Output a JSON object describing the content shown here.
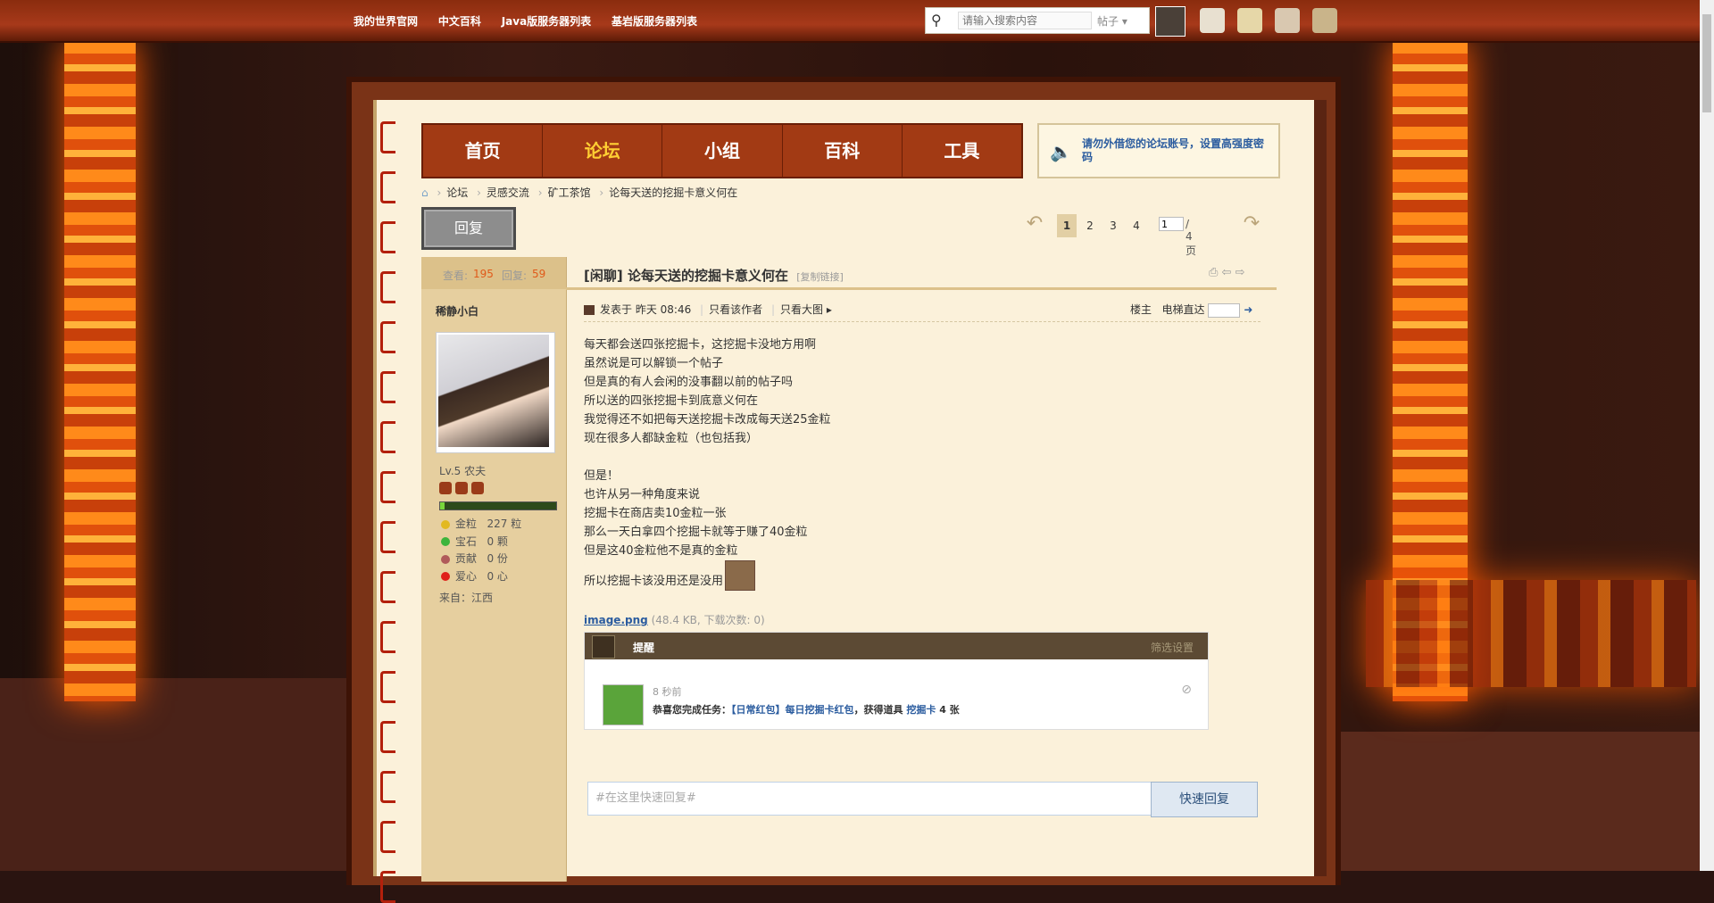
{
  "topnav": [
    "我的世界官网",
    "中文百科",
    "Java版服务器列表",
    "基岩版服务器列表"
  ],
  "search": {
    "placeholder": "请输入搜索内容",
    "type": "帖子"
  },
  "mainnav": [
    "首页",
    "论坛",
    "小组",
    "百科",
    "工具"
  ],
  "notice": "请勿外借您的论坛账号，设置高强度密码",
  "breadcrumb": [
    "论坛",
    "灵感交流",
    "矿工茶馆",
    "论每天送的挖掘卡意义何在"
  ],
  "reply_button": "回复",
  "pager": {
    "pages": [
      "1",
      "2",
      "3",
      "4"
    ],
    "current": "1",
    "input": "1",
    "total": "/ 4 页"
  },
  "stats": {
    "views_label": "查看:",
    "views": "195",
    "replies_label": "回复:",
    "replies": "59"
  },
  "author": {
    "name": "稀静小白",
    "level": "Lv.5 农夫",
    "xp_fraction": 0.04,
    "gold_label": "金粒",
    "gold": "227 粒",
    "gem_label": "宝石",
    "gem": "0 颗",
    "contrib_label": "贡献",
    "contrib": "0 份",
    "love_label": "爱心",
    "love": "0 心",
    "from": "来自：江西"
  },
  "post": {
    "tag": "[闲聊]",
    "title": "论每天送的挖掘卡意义何在",
    "copy_link": "[复制链接]",
    "posted": "发表于 昨天 08:46",
    "only_author": "只看该作者",
    "big_image": "只看大图",
    "floor_label": "楼主",
    "jump_label": "电梯直达",
    "lines": [
      "每天都会送四张挖掘卡，这挖掘卡没地方用啊",
      "虽然说是可以解锁一个帖子",
      "但是真的有人会闲的没事翻以前的帖子吗",
      "所以送的四张挖掘卡到底意义何在",
      "我觉得还不如把每天送挖掘卡改成每天送25金粒",
      "现在很多人都缺金粒（也包括我）",
      "",
      "但是！",
      "也许从另一种角度来说",
      "挖掘卡在商店卖10金粒一张",
      "那么一天白拿四个挖掘卡就等于赚了40金粒",
      "但是这40金粒他不是真的金粒"
    ],
    "last_line": "所以挖掘卡该没用还是没用",
    "attachment": "image.png",
    "attachment_info": "(48.4 KB, 下载次数: 0)"
  },
  "popup": {
    "title": "提醒",
    "settings": "筛选设置",
    "time": "8 秒前",
    "msg_pre": "恭喜您完成任务：",
    "task": "【日常红包】每日挖掘卡红包",
    "msg_mid": "，获得道具",
    "item": "挖掘卡",
    "msg_post": "4 张"
  },
  "quick_reply": {
    "placeholder": "#在这里快速回复#",
    "button": "快速回复"
  },
  "colors": {
    "nav": "#a23a14",
    "active_nav": "#ffcf33",
    "link": "#2b5c9f",
    "paper": "#fbf1da"
  }
}
